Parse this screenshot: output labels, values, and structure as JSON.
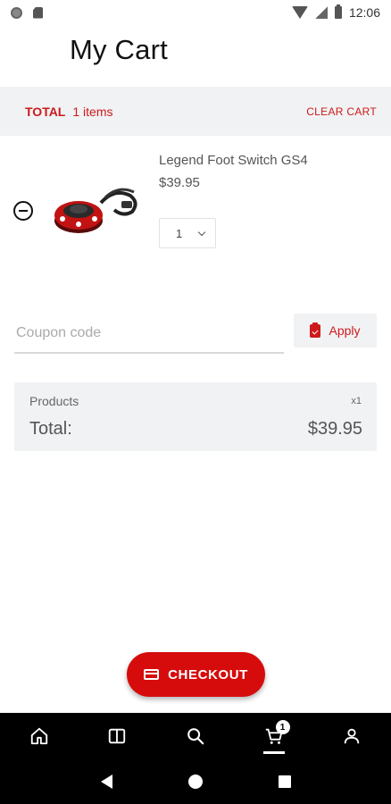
{
  "status_bar": {
    "time": "12:06"
  },
  "header": {
    "title": "My Cart"
  },
  "total_bar": {
    "label": "TOTAL",
    "items": "1 items",
    "clear_label": "CLEAR CART"
  },
  "cart": {
    "items": [
      {
        "name": "Legend Foot Switch GS4",
        "price": "$39.95",
        "quantity": "1"
      }
    ]
  },
  "coupon": {
    "placeholder": "Coupon code",
    "apply_label": "Apply"
  },
  "summary": {
    "products_label": "Products",
    "products_qty": "x1",
    "total_label": "Total:",
    "total_value": "$39.95"
  },
  "checkout": {
    "label": "CHECKOUT"
  },
  "bottom_nav": {
    "cart_badge": "1",
    "active": "cart"
  },
  "colors": {
    "accent": "#d60c0c",
    "panel": "#f1f2f4",
    "nav": "#000000"
  }
}
